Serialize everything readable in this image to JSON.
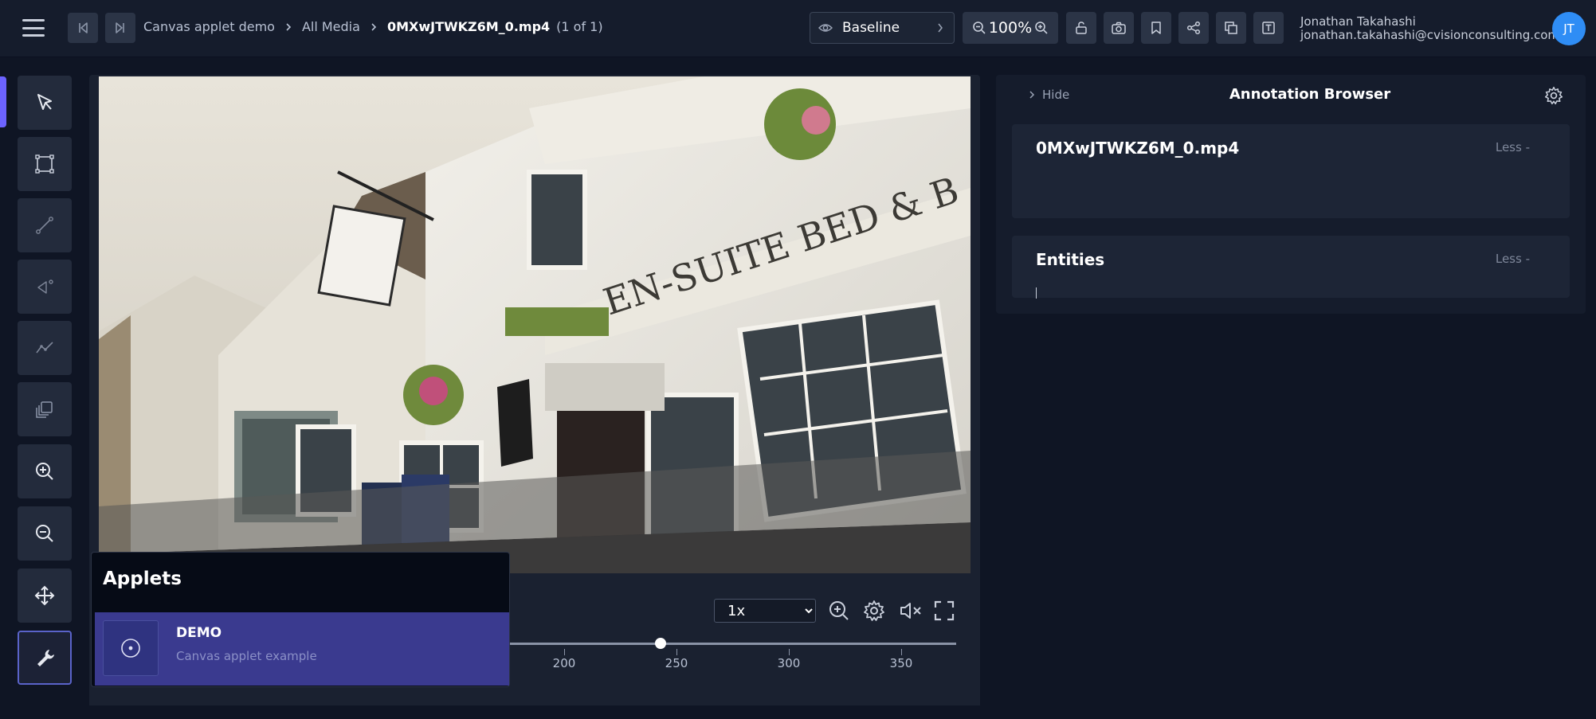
{
  "header": {
    "breadcrumbs": [
      "Canvas applet demo",
      "All Media"
    ],
    "current_file": "0MXwJTWKZ6M_0.mp4",
    "file_count": "(1 of 1)",
    "version": "Baseline",
    "zoom": "100%",
    "user_name": "Jonathan Takahashi",
    "user_email": "jonathan.takahashi@cvisionconsulting.com",
    "avatar_initials": "JT",
    "accent_color": "#6c63ff"
  },
  "toolbar": {
    "tools": [
      "pointer-icon",
      "box-icon",
      "line-icon",
      "point-icon",
      "track-icon",
      "copy-icon",
      "zoom-in-icon",
      "zoom-out-icon",
      "pan-icon",
      "wrench-icon"
    ],
    "active_tool": "pointer-icon"
  },
  "player": {
    "speed_options": [
      "1x"
    ],
    "speed_selected": "1x",
    "timeline_ticks": [
      "200",
      "250",
      "300",
      "350"
    ],
    "current_frame_value": 245
  },
  "applets": {
    "title": "Applets",
    "items": [
      {
        "name": "DEMO",
        "description": "Canvas applet example"
      }
    ]
  },
  "annotation_browser": {
    "hide_label": "Hide",
    "title": "Annotation Browser",
    "media_card_title": "0MXwJTWKZ6M_0.mp4",
    "media_card_toggle": "Less -",
    "entities_card_title": "Entities",
    "entities_card_toggle": "Less -"
  }
}
